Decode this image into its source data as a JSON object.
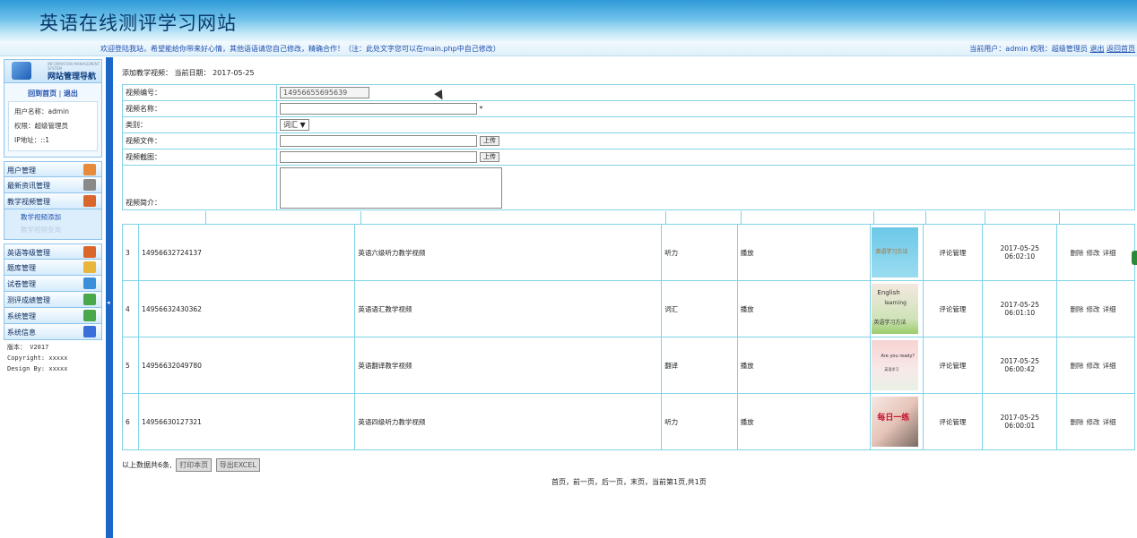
{
  "header": {
    "title": "英语在线测评学习网站"
  },
  "topbar": {
    "marquee": "欢迎登陆我站，希望能给你带来好心情，其他语语请您自己修改，精确合作！（注：此处文字您可以在main.php中自己修改）",
    "user_info": "当前用户：admin 权限：超级管理员",
    "logout": "退出",
    "home": "返回首页"
  },
  "sidebar": {
    "nav_small": "INFORMATION MANAGEMENT SYSTEM",
    "nav_title": "网站管理导航",
    "home_link": "回到首页",
    "separator": "|",
    "exit_link": "退出",
    "username": "用户名称：admin",
    "role": "权限：超级管理员",
    "ip": "IP地址：::1",
    "menu_top": [
      {
        "label": "用户管理",
        "color": "#e58b3a"
      },
      {
        "label": "最新资讯管理",
        "color": "#777"
      },
      {
        "label": "教学视频管理",
        "color": "#d9662a"
      }
    ],
    "sub_items": [
      "教学视频添加",
      "教学视频查询"
    ],
    "menu_bottom": [
      {
        "label": "英语等级管理",
        "color": "#d9662a"
      },
      {
        "label": "题库管理",
        "color": "#e8b63a"
      },
      {
        "label": "试卷管理",
        "color": "#3a8fd9"
      },
      {
        "label": "测评成绩管理",
        "color": "#4aa84a"
      },
      {
        "label": "系统管理",
        "color": "#4aa84a"
      },
      {
        "label": "系统信息",
        "color": "#3a6fd9"
      }
    ],
    "version": "版本： V2017",
    "copyright": "Copyright: xxxxx",
    "design": "Design By:  xxxxx"
  },
  "form": {
    "heading": "添加教学视频：  当前日期： 2017-05-25",
    "fields": {
      "id_label": "视频编号：",
      "id_value": "14956655695639",
      "name_label": "视频名称：",
      "name_required": "*",
      "category_label": "类别：",
      "category_value": "词汇 ▼",
      "file_label": "视频文件：",
      "upload1": "上传",
      "shot_label": "视频截图：",
      "upload2": "上传",
      "intro_label": "视频简介："
    }
  },
  "table": {
    "rows": [
      {
        "no": "3",
        "code": "14956632724137",
        "name": "英语六级听力教学视频",
        "type": "听力",
        "play": "播放",
        "comment": "评论管理",
        "time": "2017-05-25 06:02:10",
        "thumb": "owl"
      },
      {
        "no": "4",
        "code": "14956632430362",
        "name": "英语语汇教学视频",
        "type": "词汇",
        "play": "播放",
        "comment": "评论管理",
        "time": "2017-05-25 06:01:10",
        "thumb": "english"
      },
      {
        "no": "5",
        "code": "14956632049780",
        "name": "英语翻译教学视频",
        "type": "翻译",
        "play": "播放",
        "comment": "评论管理",
        "time": "2017-05-25 06:00:42",
        "thumb": "ready"
      },
      {
        "no": "6",
        "code": "14956630127321",
        "name": "英语四级听力教学视频",
        "type": "听力",
        "play": "播放",
        "comment": "评论管理",
        "time": "2017-05-25 06:00:01",
        "thumb": "daily"
      }
    ],
    "op_delete": "删除",
    "op_edit": "修改",
    "op_detail": "详细",
    "thumb_text": {
      "owl_1": "英语学习方法",
      "english_1": "English",
      "english_2": "learning",
      "english_3": "英语学习方法",
      "ready_1": "Are you ready？",
      "ready_2": "英语学习",
      "daily_1": "每日一练"
    }
  },
  "footer": {
    "total": "以上数据共6条,",
    "print_btn": "打印本页",
    "excel_btn": "导出EXCEL",
    "pager": "首页，前一页，后一页，末页，当前第1页,共1页"
  },
  "colors": {
    "accent": "#1b67c7",
    "grid": "#7fd3e6",
    "title": "#0a3a6b"
  }
}
